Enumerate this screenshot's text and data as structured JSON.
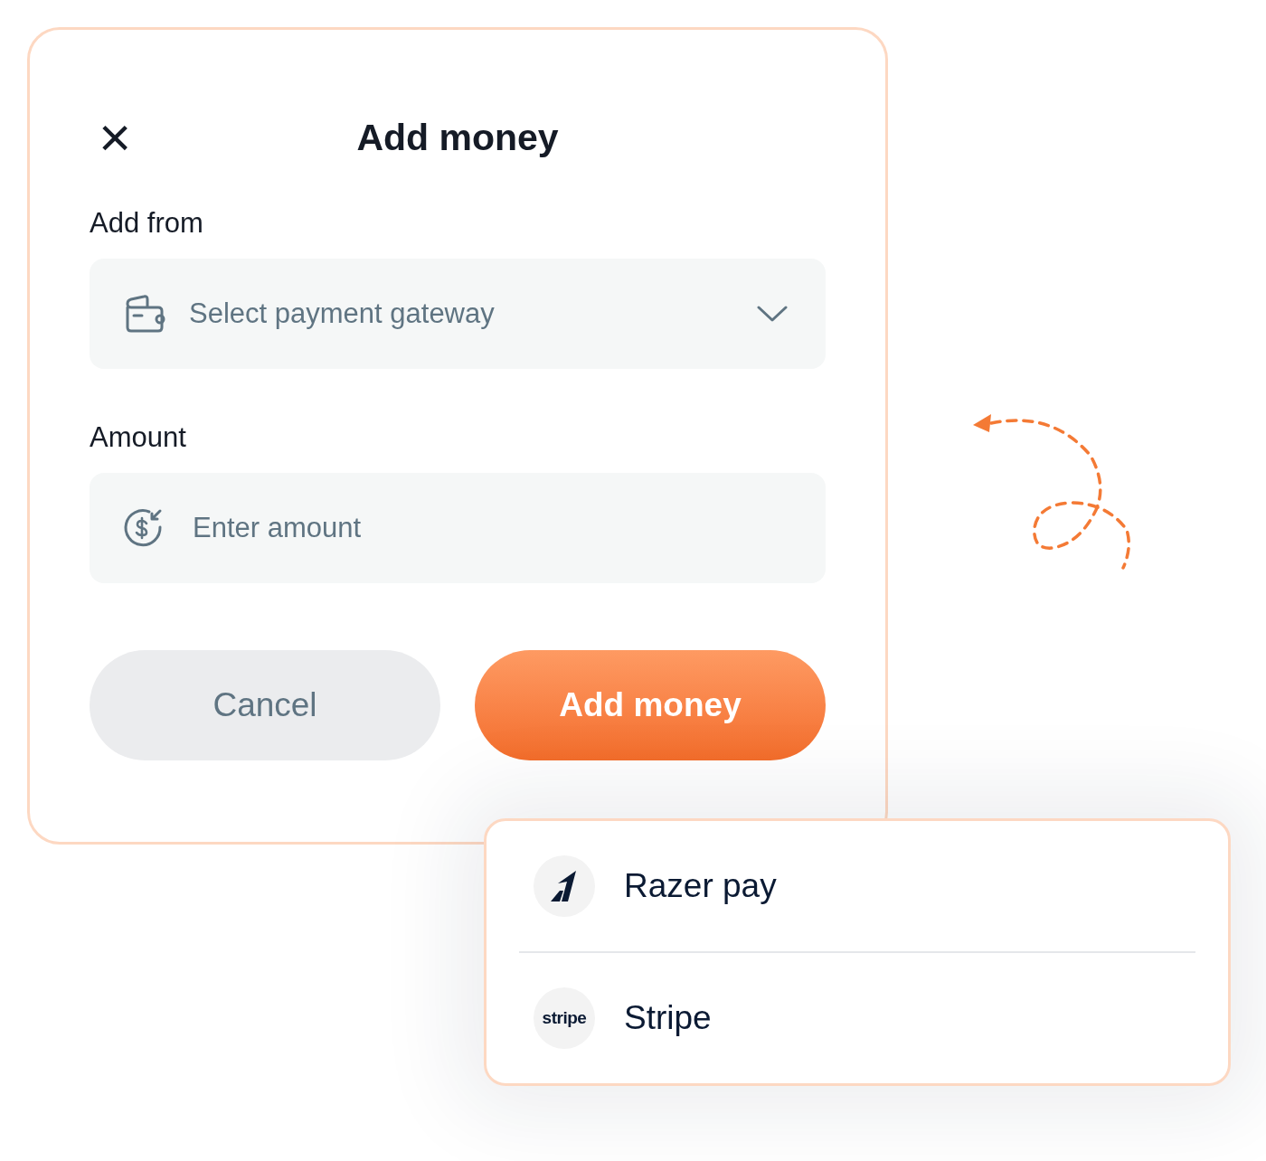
{
  "dialog": {
    "title": "Add money",
    "close_icon": "×"
  },
  "fields": [
    {
      "kind": "select",
      "label": "Add from",
      "placeholder": "Select payment gateway"
    },
    {
      "kind": "input",
      "label": "Amount",
      "placeholder": "Enter amount"
    }
  ],
  "buttons": [
    {
      "kind": "secondary",
      "label": "Cancel"
    },
    {
      "kind": "primary",
      "label": "Add money"
    }
  ],
  "gateway_menu": [
    {
      "kind": "razorpay",
      "label": "Razer pay"
    },
    {
      "kind": "stripe",
      "logo_text": "stripe",
      "label": "Stripe"
    }
  ]
}
